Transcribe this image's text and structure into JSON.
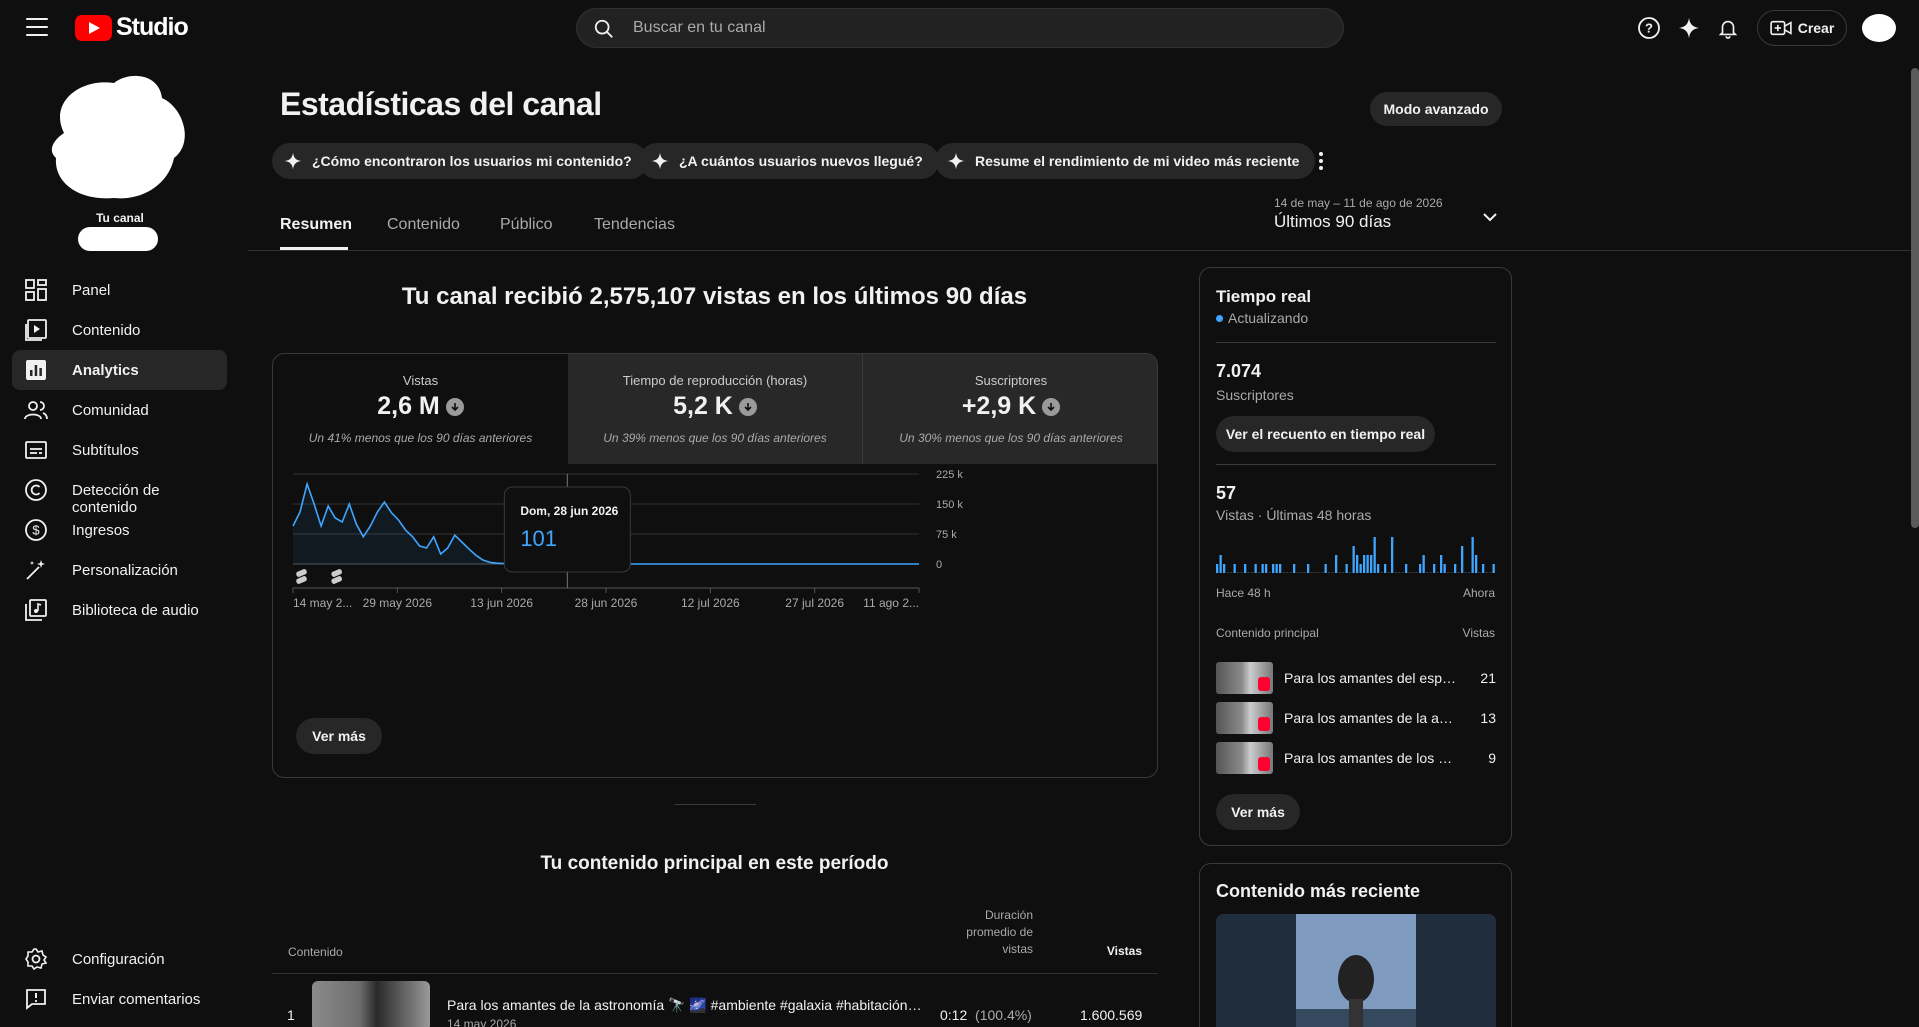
{
  "app": {
    "logo_text": "Studio"
  },
  "search": {
    "placeholder": "Buscar en tu canal"
  },
  "topbar": {
    "create_label": "Crear",
    "icons": [
      "help-icon",
      "sparkle-icon",
      "bell-icon",
      "create-video-icon"
    ]
  },
  "channel": {
    "label": "Tu canal"
  },
  "sidebar": {
    "items": [
      {
        "label": "Panel",
        "icon": "dashboard-icon"
      },
      {
        "label": "Contenido",
        "icon": "content-icon"
      },
      {
        "label": "Analytics",
        "icon": "analytics-icon",
        "active": true
      },
      {
        "label": "Comunidad",
        "icon": "community-icon"
      },
      {
        "label": "Subtítulos",
        "icon": "subtitles-icon"
      },
      {
        "label": "Detección de contenido",
        "icon": "copyright-icon"
      },
      {
        "label": "Ingresos",
        "icon": "dollar-icon"
      },
      {
        "label": "Personalización",
        "icon": "wand-icon"
      },
      {
        "label": "Biblioteca de audio",
        "icon": "audio-library-icon"
      }
    ],
    "bottom": [
      {
        "label": "Configuración",
        "icon": "gear-icon"
      },
      {
        "label": "Enviar comentarios",
        "icon": "feedback-icon"
      }
    ]
  },
  "page": {
    "title": "Estadísticas del canal",
    "advanced_mode": "Modo avanzado",
    "chips": [
      "¿Cómo encontraron los usuarios mi contenido?",
      "¿A cuántos usuarios nuevos llegué?",
      "Resume el rendimiento de mi video más reciente"
    ],
    "tabs": [
      "Resumen",
      "Contenido",
      "Público",
      "Tendencias"
    ],
    "date_range": "14 de may – 11 de ago de 2026",
    "date_label": "Últimos 90 días"
  },
  "overview": {
    "headline": "Tu canal recibió 2,575,107 vistas en los últimos 90 días",
    "metrics": [
      {
        "label": "Vistas",
        "value": "2,6 M",
        "compare": "Un 41% menos que los 90 días anteriores"
      },
      {
        "label": "Tiempo de reproducción (horas)",
        "value": "5,2 K",
        "compare": "Un 39% menos que los 90 días anteriores"
      },
      {
        "label": "Suscriptores",
        "value": "+2,9 K",
        "compare": "Un 30% menos que los 90 días anteriores"
      }
    ],
    "tooltip": {
      "date": "Dom, 28 jun 2026",
      "value": "101"
    },
    "see_more": "Ver más"
  },
  "chart_data": {
    "type": "area",
    "title": "",
    "xlabel": "",
    "ylabel": "",
    "x_tick_labels": [
      "14 may 2...",
      "29 may 2026",
      "13 jun 2026",
      "28 jun 2026",
      "12 jul 2026",
      "27 jul 2026",
      "11 ago 2..."
    ],
    "y_tick_labels": [
      "225 k",
      "150 k",
      "75 k",
      "0"
    ],
    "ylim": [
      0,
      225000
    ],
    "grid": true,
    "series": [
      {
        "values": [
          95000,
          130000,
          200000,
          150000,
          95000,
          145000,
          115000,
          105000,
          150000,
          100000,
          68000,
          95000,
          130000,
          155000,
          128000,
          110000,
          85000,
          68000,
          45000,
          40000,
          68000,
          25000,
          40000,
          72000,
          55000,
          38000,
          22000,
          10000,
          4000,
          2000,
          1000,
          500,
          300,
          200,
          150,
          120,
          110,
          105,
          102,
          101,
          101,
          100,
          100,
          100,
          100,
          100,
          100,
          100,
          100,
          100,
          100,
          100,
          100,
          100,
          100,
          100,
          100,
          100,
          100,
          100,
          100,
          100,
          100,
          100,
          100,
          100,
          100,
          100,
          100,
          100,
          100,
          100,
          100,
          100,
          100,
          100,
          100,
          100,
          100,
          100,
          100,
          100,
          100,
          100,
          100,
          100,
          100,
          100,
          100,
          100
        ]
      }
    ],
    "highlight": {
      "date": "Dom, 28 jun 2026",
      "value": 101
    }
  },
  "realtime": {
    "title": "Tiempo real",
    "status": "Actualizando",
    "subscribers_value": "7.074",
    "subscribers_label": "Suscriptores",
    "realtime_button": "Ver el recuento en tiempo real",
    "views_value": "57",
    "views_label": "Vistas · Últimas 48 horas",
    "axis_start": "Hace 48 h",
    "axis_end": "Ahora",
    "bars": [
      1,
      2,
      1,
      0,
      0,
      1,
      0,
      0,
      1,
      0,
      0,
      1,
      0,
      1,
      1,
      0,
      1,
      1,
      1,
      0,
      0,
      0,
      1,
      0,
      0,
      0,
      1,
      0,
      0,
      0,
      0,
      1,
      0,
      0,
      2,
      0,
      0,
      1,
      0,
      3,
      2,
      1,
      2,
      2,
      2,
      4,
      1,
      0,
      1,
      0,
      4,
      0,
      0,
      0,
      1,
      0,
      0,
      0,
      1,
      2,
      0,
      0,
      1,
      0,
      2,
      1,
      0,
      0,
      1,
      0,
      3,
      0,
      0,
      4,
      2,
      0,
      1,
      0,
      0,
      1
    ],
    "top_header": "Contenido principal",
    "top_header_right": "Vistas",
    "top_items": [
      {
        "title": "Para los amantes del espacio",
        "views": "21"
      },
      {
        "title": "Para los amantes de la astronomía",
        "views": "13"
      },
      {
        "title": "Para los amantes de los agujeros negros",
        "views": "9"
      }
    ],
    "see_more": "Ver más"
  },
  "latest": {
    "title": "Contenido más reciente"
  },
  "top_content": {
    "title": "Tu contenido principal en este período",
    "col_content": "Contenido",
    "col_duration": "Duración promedio de vistas",
    "col_views": "Vistas",
    "rows": [
      {
        "rank": "1",
        "title": "Para los amantes de la astronomía 🔭 🌌 #ambiente #galaxia #habitación #ambienteacogedor",
        "date": "14 may 2026",
        "duration": "0:12",
        "duration_pct": "(100.4%)",
        "views": "1.600.569"
      }
    ]
  },
  "colors": {
    "accent": "#3ea6ff",
    "brand": "#ff0000",
    "background": "#0f0f0f"
  }
}
